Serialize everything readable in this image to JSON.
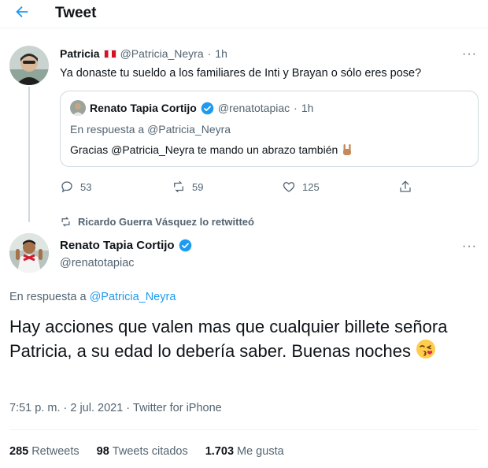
{
  "header": {
    "title": "Tweet"
  },
  "parent_tweet": {
    "name": "Patricia",
    "handle": "@Patricia_Neyra",
    "dot": "·",
    "time": "1h",
    "text": "Ya donaste tu sueldo a los familiares de Inti y Brayan o sólo eres pose?",
    "more": "···",
    "quoted": {
      "name": "Renato Tapia Cortijo",
      "handle": "@renatotapiac",
      "dot": "·",
      "time": "1h",
      "reply_prefix": "En respuesta a ",
      "reply_handle": "@Patricia_Neyra",
      "text": "Gracias @Patricia_Neyra te mando un abrazo también"
    },
    "actions": {
      "replies": "53",
      "retweets": "59",
      "likes": "125"
    }
  },
  "retweet_notice": "Ricardo Guerra Vásquez lo retwitteó",
  "main_tweet": {
    "name": "Renato Tapia Cortijo",
    "handle": "@renatotapiac",
    "more": "···",
    "reply_prefix": "En respuesta a ",
    "reply_handle": "@Patricia_Neyra",
    "text": "Hay acciones que valen mas que cualquier billete señora Patricia, a su edad lo debería saber. Buenas noches",
    "meta": "7:51 p. m. · 2 jul. 2021 · Twitter for iPhone"
  },
  "stats": {
    "retweets_count": "285",
    "retweets_label": "Retweets",
    "quotes_count": "98",
    "quotes_label": "Tweets citados",
    "likes_count": "1.703",
    "likes_label": "Me gusta"
  },
  "colors": {
    "accent": "#1d9bf0",
    "muted": "#536471",
    "border": "#cfd9de"
  },
  "icons": [
    "back-arrow-icon",
    "verified-icon",
    "reply-icon",
    "retweet-icon",
    "like-icon",
    "share-icon",
    "peru-flag-icon",
    "rock-hand-emoji",
    "kiss-face-emoji"
  ]
}
